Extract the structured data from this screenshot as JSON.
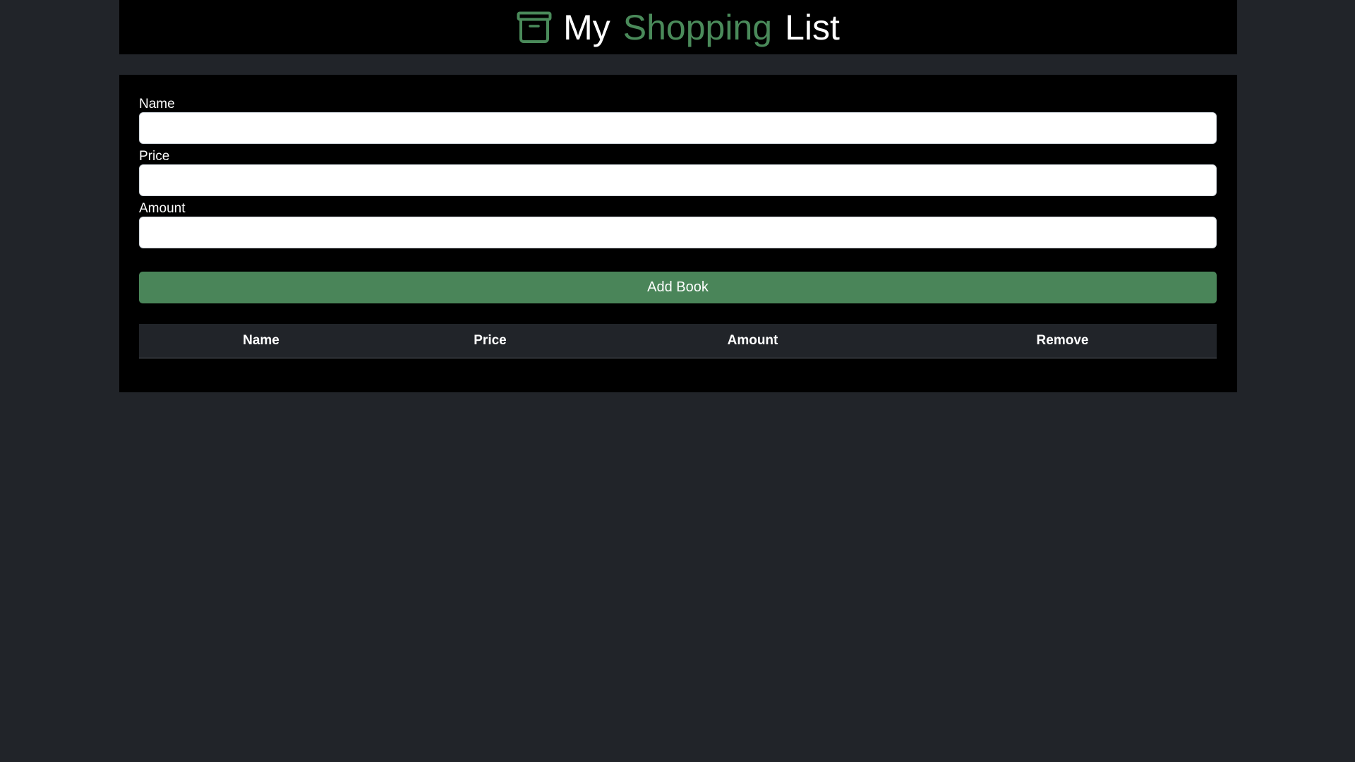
{
  "header": {
    "title_words": [
      "My",
      "Shopping",
      "List"
    ],
    "icon": "archive-box-icon",
    "accent_color": "#4a8a5a"
  },
  "form": {
    "fields": [
      {
        "label": "Name",
        "value": "",
        "placeholder": ""
      },
      {
        "label": "Price",
        "value": "",
        "placeholder": ""
      },
      {
        "label": "Amount",
        "value": "",
        "placeholder": ""
      }
    ],
    "submit_label": "Add Book",
    "submit_color": "#4a8559"
  },
  "table": {
    "columns": [
      "Name",
      "Price",
      "Amount",
      "Remove"
    ],
    "rows": []
  },
  "colors": {
    "page_background": "#212429",
    "panel_background": "#000000"
  }
}
